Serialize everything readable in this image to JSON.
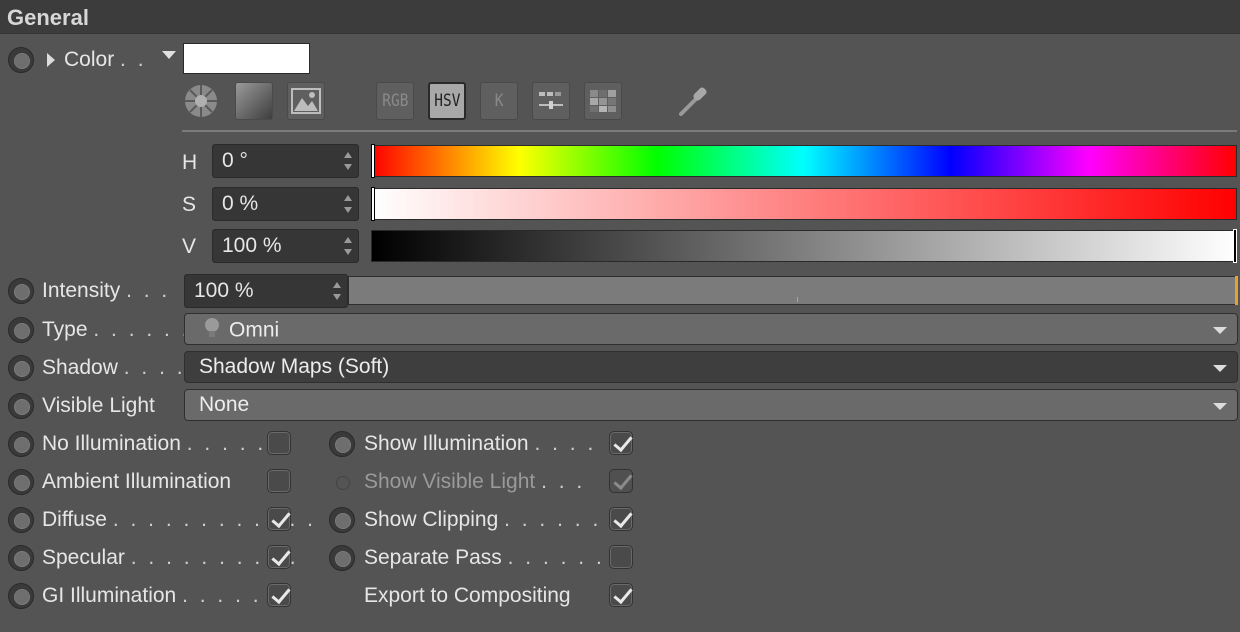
{
  "section": {
    "title": "General"
  },
  "color": {
    "label": "Color",
    "dots": ". .",
    "swatch_hex": "#ffffff"
  },
  "toolbar": {
    "icons": [
      "color-wheel-icon",
      "gradient-icon",
      "image-icon",
      "rgb-mode",
      "hsv-mode",
      "kelvin-mode",
      "mixer-icon",
      "swatches-icon",
      "eyedropper-icon"
    ],
    "rgb_label": "RGB",
    "hsv_label": "HSV",
    "k_label": "K",
    "active_mode": "HSV"
  },
  "hsv": {
    "h": {
      "label": "H",
      "value": "0 °",
      "fraction": 0.0
    },
    "s": {
      "label": "S",
      "value": "0 %",
      "fraction": 0.0
    },
    "v": {
      "label": "V",
      "value": "100 %",
      "fraction": 1.0
    }
  },
  "intensity": {
    "label": "Intensity",
    "dots": ". . .",
    "value": "100 %",
    "fraction": 1.0
  },
  "type": {
    "label": "Type",
    "dots": ". . . . . . .",
    "value": "Omni"
  },
  "shadow": {
    "label": "Shadow",
    "dots": ". . . .",
    "value": "Shadow Maps (Soft)"
  },
  "visible_light": {
    "label": "Visible Light",
    "value": "None"
  },
  "options_left": [
    {
      "label": "No Illumination",
      "dots": ". . . . .",
      "checked": false
    },
    {
      "label": "Ambient Illumination",
      "dots": "",
      "checked": false
    },
    {
      "label": "Diffuse",
      "dots": ". . . . . . . . . . . .",
      "checked": true
    },
    {
      "label": "Specular",
      "dots": ". . . . . . . . . .",
      "checked": true
    },
    {
      "label": "GI Illumination",
      "dots": ". . . . .",
      "checked": true
    }
  ],
  "options_right": [
    {
      "label": "Show Illumination",
      "dots": ". . . .",
      "checked": true,
      "enabled": true
    },
    {
      "label": "Show Visible Light",
      "dots": ". . .",
      "checked": true,
      "enabled": false
    },
    {
      "label": "Show Clipping",
      "dots": ". . . . . .",
      "checked": true,
      "enabled": true
    },
    {
      "label": "Separate Pass",
      "dots": ". . . . . . .",
      "checked": false,
      "enabled": true
    },
    {
      "label": "Export to Compositing",
      "dots": "",
      "checked": true,
      "enabled": true
    }
  ]
}
